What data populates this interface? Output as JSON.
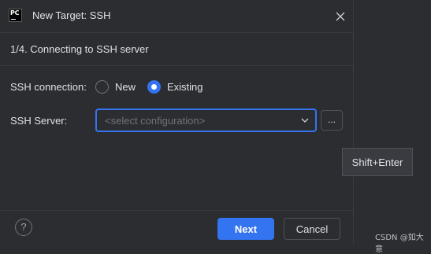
{
  "window": {
    "app_icon_text": "PC",
    "title": "New Target: SSH"
  },
  "step": {
    "text": "1/4. Connecting to SSH server"
  },
  "connection": {
    "label": "SSH connection:",
    "options": [
      {
        "label": "New",
        "selected": false
      },
      {
        "label": "Existing",
        "selected": true
      }
    ]
  },
  "server": {
    "label": "SSH Server:",
    "placeholder": "<select configuration>",
    "browse_label": "..."
  },
  "tooltip": {
    "text": "Shift+Enter"
  },
  "footer": {
    "help_label": "?",
    "next_label": "Next",
    "cancel_label": "Cancel"
  },
  "watermark": {
    "text": "CSDN @如大意"
  },
  "colors": {
    "accent": "#3574f0",
    "background": "#2b2d30",
    "text": "#dfe1e5",
    "muted": "#6f737a"
  }
}
